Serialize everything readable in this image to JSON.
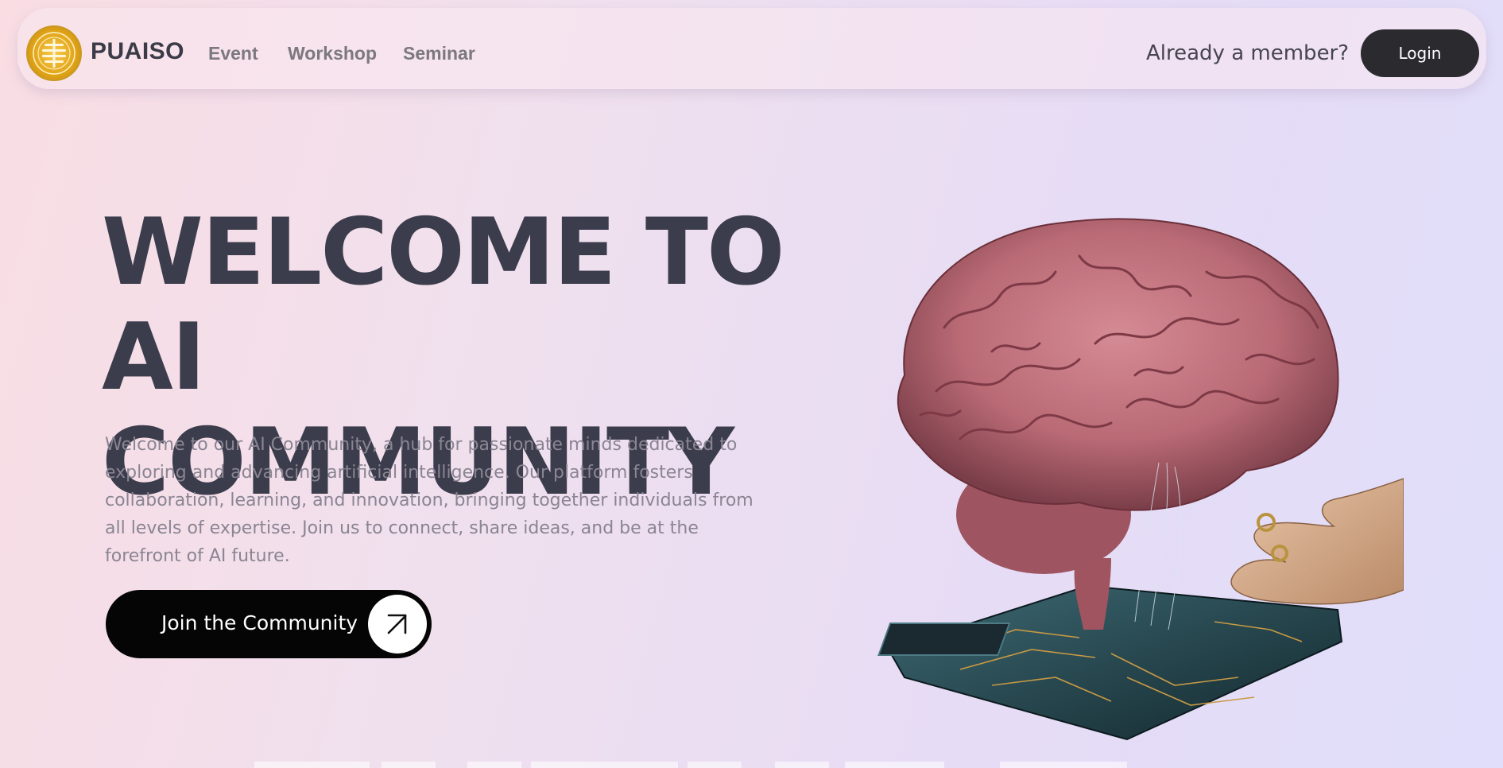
{
  "nav": {
    "brand": "PUAISO",
    "links": [
      "Event",
      "Workshop",
      "Seminar"
    ],
    "member_prompt": "Already a member?",
    "login_label": "Login",
    "logo_icon": "puaiso-logo-icon"
  },
  "hero": {
    "title_line1": "WELCOME TO",
    "title_line2": "AI COMMUNITY",
    "description": "Welcome to our AI Community, a hub for passionate minds dedicated to exploring and advancing artificial intelligence. Our platform fosters collaboration, learning, and innovation, bringing together individuals from all levels of expertise. Join us to connect, share ideas, and be at the forefront of AI future.",
    "cta_label": "Join the Community",
    "cta_icon": "arrow-up-right-icon",
    "image": "brain-on-chip-illustration"
  },
  "colors": {
    "title": "#3c3d4c",
    "text_muted": "#8a8593",
    "button_dark": "#2a2a2f",
    "cta_bg": "#050505"
  }
}
